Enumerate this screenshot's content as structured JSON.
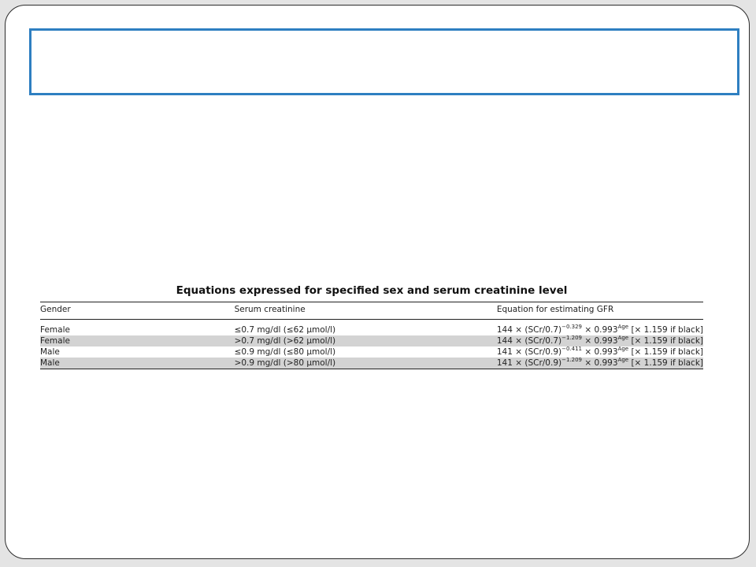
{
  "title_box": {
    "text": ""
  },
  "table": {
    "title": "Equations expressed for specified sex and serum creatinine level",
    "headers": [
      "Gender",
      "Serum creatinine",
      "Equation for estimating GFR"
    ],
    "rows": [
      {
        "gender": "Female",
        "creatinine": "≤0.7 mg/dl (≤62 μmol/l)",
        "eq_base": "144 × (SCr/0.7)",
        "eq_exp": "−0.329",
        "eq_mid": " × 0.993",
        "eq_age": "Age",
        "eq_tail": " [× 1.159 if black]",
        "shaded": false
      },
      {
        "gender": "Female",
        "creatinine": ">0.7 mg/dl (>62 μmol/l)",
        "eq_base": "144 × (SCr/0.7)",
        "eq_exp": "−1.209",
        "eq_mid": " × 0.993",
        "eq_age": "Age",
        "eq_tail": " [× 1.159 if black]",
        "shaded": true
      },
      {
        "gender": "Male",
        "creatinine": "≤0.9 mg/dl (≤80 μmol/l)",
        "eq_base": "141 × (SCr/0.9)",
        "eq_exp": "−0.411",
        "eq_mid": " × 0.993",
        "eq_age": "Age",
        "eq_tail": " [× 1.159 if black]",
        "shaded": false
      },
      {
        "gender": "Male",
        "creatinine": ">0.9 mg/dl (>80 μmol/l)",
        "eq_base": "141 × (SCr/0.9)",
        "eq_exp": "−1.209",
        "eq_mid": " × 0.993",
        "eq_age": "Age",
        "eq_tail": " [× 1.159 if black]",
        "shaded": true
      }
    ]
  },
  "colors": {
    "title_box_border": "#2e7fc1",
    "row_shade": "#d3d3d3",
    "slide_border": "#2b2b2b"
  }
}
